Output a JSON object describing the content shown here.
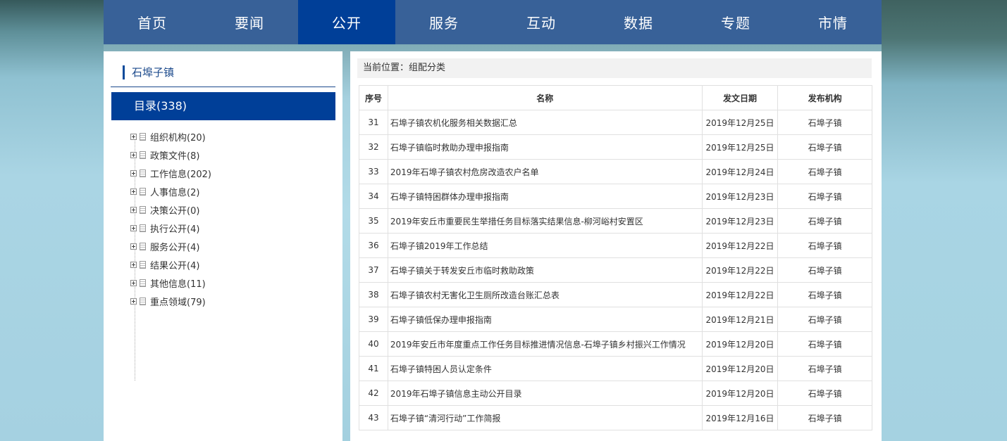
{
  "nav": [
    "首页",
    "要闻",
    "公开",
    "服务",
    "互动",
    "数据",
    "专题",
    "市情"
  ],
  "nav_active_index": 2,
  "left": {
    "title": "石埠子镇",
    "catalog": "目录(338)",
    "tree": [
      "组织机构(20)",
      "政策文件(8)",
      "工作信息(202)",
      "人事信息(2)",
      "决策公开(0)",
      "执行公开(4)",
      "服务公开(4)",
      "结果公开(4)",
      "其他信息(11)",
      "重点领域(79)"
    ]
  },
  "breadcrumb": "当前位置：组配分类",
  "table": {
    "headers": [
      "序号",
      "名称",
      "发文日期",
      "发布机构"
    ],
    "rows": [
      [
        "31",
        "石埠子镇农机化服务相关数据汇总",
        "2019年12月25日",
        "石埠子镇"
      ],
      [
        "32",
        "石埠子镇临时救助办理申报指南",
        "2019年12月25日",
        "石埠子镇"
      ],
      [
        "33",
        "2019年石埠子镇农村危房改造农户名单",
        "2019年12月24日",
        "石埠子镇"
      ],
      [
        "34",
        "石埠子镇特困群体办理申报指南",
        "2019年12月23日",
        "石埠子镇"
      ],
      [
        "35",
        "2019年安丘市重要民生举措任务目标落实结果信息-柳河峪村安置区",
        "2019年12月23日",
        "石埠子镇"
      ],
      [
        "36",
        "石埠子镇2019年工作总结",
        "2019年12月22日",
        "石埠子镇"
      ],
      [
        "37",
        "石埠子镇关于转发安丘市临时救助政策",
        "2019年12月22日",
        "石埠子镇"
      ],
      [
        "38",
        "石埠子镇农村无害化卫生厕所改造台账汇总表",
        "2019年12月22日",
        "石埠子镇"
      ],
      [
        "39",
        "石埠子镇低保办理申报指南",
        "2019年12月21日",
        "石埠子镇"
      ],
      [
        "40",
        "2019年安丘市年度重点工作任务目标推进情况信息-石埠子镇乡村振兴工作情况",
        "2019年12月20日",
        "石埠子镇"
      ],
      [
        "41",
        "石埠子镇特困人员认定条件",
        "2019年12月20日",
        "石埠子镇"
      ],
      [
        "42",
        "2019年石埠子镇信息主动公开目录",
        "2019年12月20日",
        "石埠子镇"
      ],
      [
        "43",
        "石埠子镇“清河行动”工作简报",
        "2019年12月16日",
        "石埠子镇"
      ]
    ]
  }
}
